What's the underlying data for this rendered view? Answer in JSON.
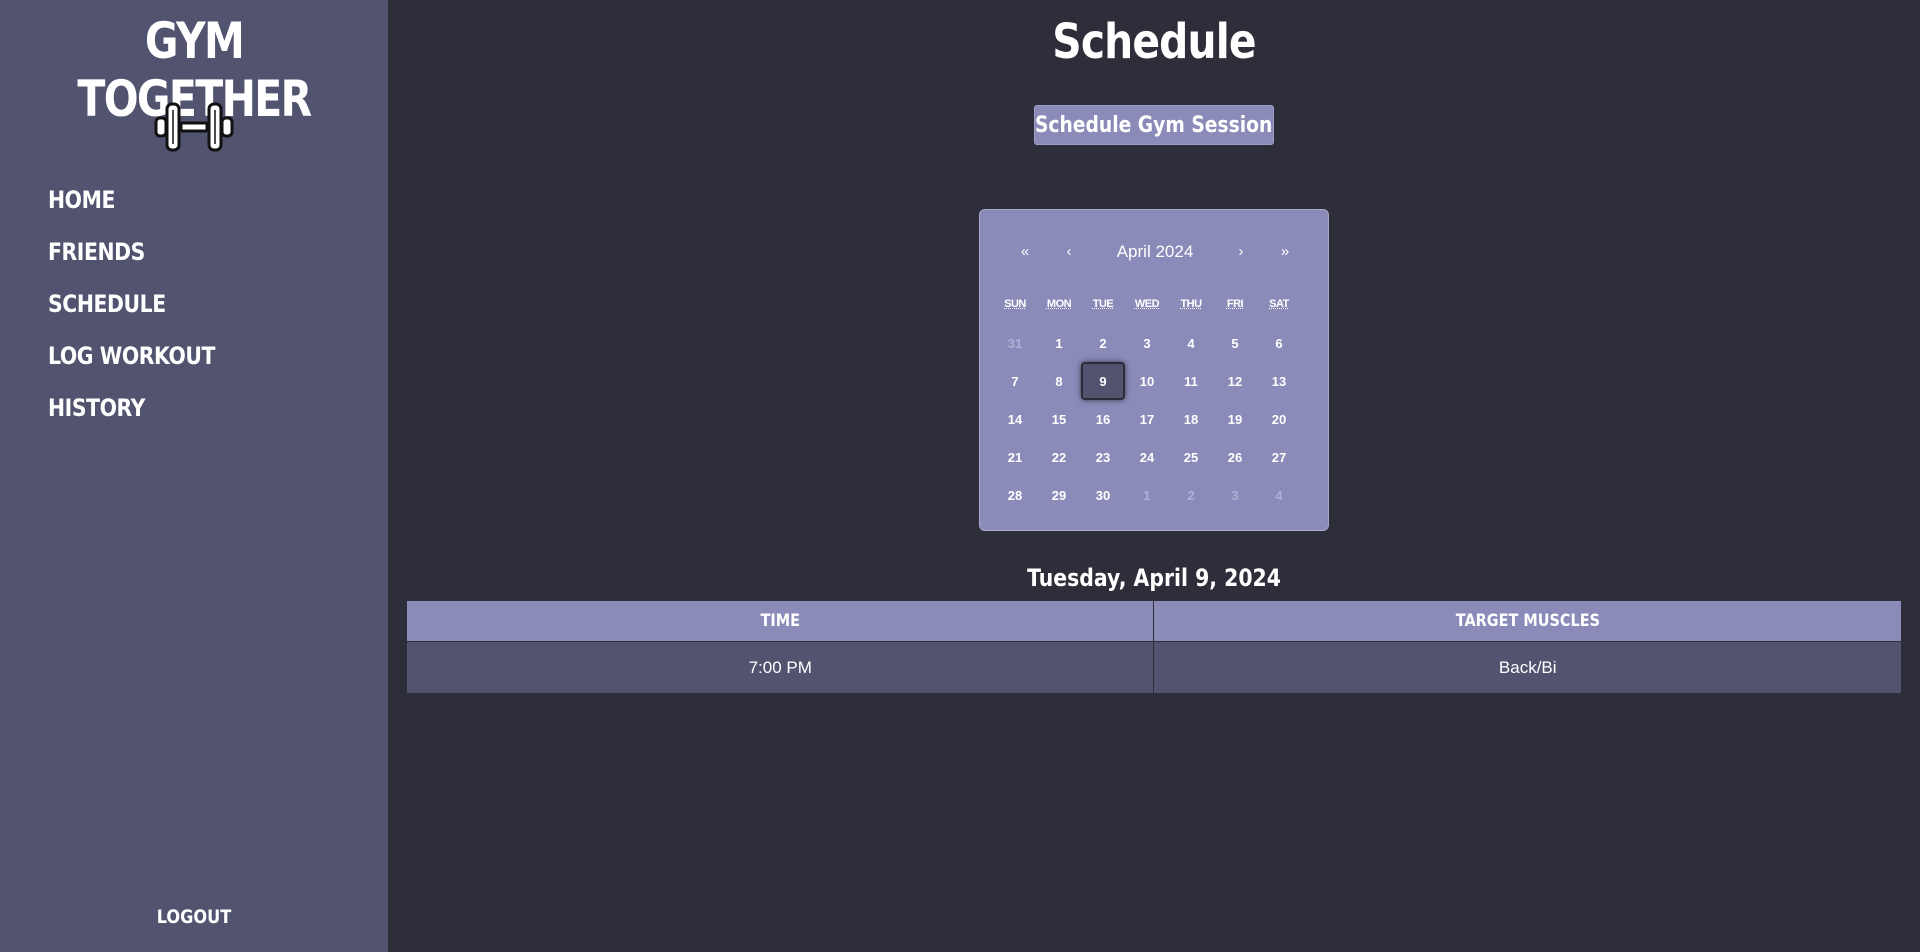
{
  "sidebar": {
    "brand": "GYM TOGETHER",
    "logo_icon": "dumbbell-icon",
    "nav": [
      {
        "label": "HOME"
      },
      {
        "label": "FRIENDS"
      },
      {
        "label": "SCHEDULE"
      },
      {
        "label": "LOG WORKOUT"
      },
      {
        "label": "HISTORY"
      }
    ],
    "logout": "LOGOUT"
  },
  "main": {
    "title": "Schedule",
    "schedule_button": "Schedule Gym Session",
    "calendar": {
      "month_label": "April 2024",
      "prev_year": "«",
      "prev_month": "‹",
      "next_month": "›",
      "next_year": "»",
      "weekdays": [
        "SUN",
        "MON",
        "TUE",
        "WED",
        "THU",
        "FRI",
        "SAT"
      ],
      "days": [
        {
          "d": "31",
          "muted": true
        },
        {
          "d": "1"
        },
        {
          "d": "2"
        },
        {
          "d": "3"
        },
        {
          "d": "4"
        },
        {
          "d": "5"
        },
        {
          "d": "6"
        },
        {
          "d": "7"
        },
        {
          "d": "8"
        },
        {
          "d": "9",
          "selected": true
        },
        {
          "d": "10"
        },
        {
          "d": "11"
        },
        {
          "d": "12"
        },
        {
          "d": "13"
        },
        {
          "d": "14"
        },
        {
          "d": "15"
        },
        {
          "d": "16"
        },
        {
          "d": "17"
        },
        {
          "d": "18"
        },
        {
          "d": "19"
        },
        {
          "d": "20"
        },
        {
          "d": "21"
        },
        {
          "d": "22"
        },
        {
          "d": "23"
        },
        {
          "d": "24"
        },
        {
          "d": "25"
        },
        {
          "d": "26"
        },
        {
          "d": "27"
        },
        {
          "d": "28"
        },
        {
          "d": "29"
        },
        {
          "d": "30"
        },
        {
          "d": "1",
          "muted": true
        },
        {
          "d": "2",
          "muted": true
        },
        {
          "d": "3",
          "muted": true
        },
        {
          "d": "4",
          "muted": true
        }
      ]
    },
    "selected_date": "Tuesday, April 9, 2024",
    "table": {
      "headers": [
        "TIME",
        "TARGET MUSCLES"
      ],
      "rows": [
        [
          "7:00 PM",
          "Back/Bi"
        ]
      ]
    }
  },
  "colors": {
    "sidebar_bg": "#52536f",
    "page_bg": "#2e2e3a",
    "accent": "#8a8bb8"
  }
}
